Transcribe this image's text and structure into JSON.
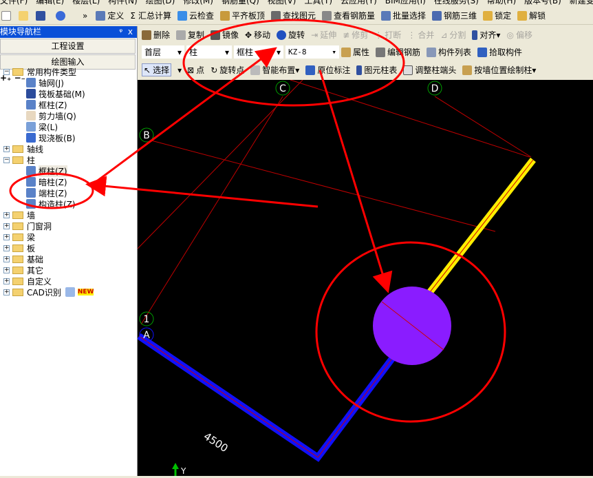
{
  "menu": [
    "文件(F)",
    "编辑(E)",
    "楼层(L)",
    "构件(N)",
    "绘图(D)",
    "修改(M)",
    "钢筋量(Q)",
    "视图(V)",
    "工具(T)",
    "云应用(Y)",
    "BIM应用(I)",
    "在线服务(S)",
    "帮助(H)",
    "版本号(B)",
    "新建变更"
  ],
  "toolbar1": [
    "定义",
    "汇总计算",
    "云检查",
    "平齐板顶",
    "查找图元",
    "查看钢筋量",
    "批量选择",
    "钢筋三维",
    "锁定",
    "解锁"
  ],
  "toolbar2": [
    {
      "label": "删除",
      "enabled": true
    },
    {
      "label": "复制",
      "enabled": true
    },
    {
      "label": "镜像",
      "enabled": true
    },
    {
      "label": "移动",
      "enabled": true
    },
    {
      "label": "旋转",
      "enabled": true
    },
    {
      "label": "延伸",
      "enabled": false
    },
    {
      "label": "修剪",
      "enabled": false
    },
    {
      "label": "打断",
      "enabled": false
    },
    {
      "label": "合并",
      "enabled": false
    },
    {
      "label": "分割",
      "enabled": false
    },
    {
      "label": "对齐",
      "enabled": true
    },
    {
      "label": "偏移",
      "enabled": false
    }
  ],
  "selectors": {
    "floor": "首层",
    "category": "柱",
    "type": "框柱",
    "component": "KZ-8"
  },
  "toolbar3": [
    "属性",
    "编辑钢筋",
    "构件列表",
    "拾取构件"
  ],
  "toolbar4": [
    "选择",
    "点",
    "旋转点",
    "智能布置",
    "原位标注",
    "图元柱表",
    "调整柱端头",
    "按墙位置绘制柱"
  ],
  "nav": {
    "title": "模块导航栏",
    "pin": "ᵠ",
    "close": "x",
    "btn1": "工程设置",
    "btn2": "绘图输入"
  },
  "tree": {
    "group1": "常用构件类型",
    "group1_items": [
      "轴网(J)",
      "筏板基础(M)",
      "框柱(Z)",
      "剪力墙(Q)",
      "梁(L)",
      "现浇板(B)"
    ],
    "axis": "轴线",
    "column": "柱",
    "column_items": [
      "框柱(Z)",
      "暗柱(Z)",
      "端柱(Z)",
      "构造柱(Z)"
    ],
    "others": [
      "墙",
      "门窗洞",
      "梁",
      "板",
      "基础",
      "其它",
      "自定义",
      "CAD识别"
    ],
    "new_badge": "NEW"
  },
  "canvas": {
    "axis_labels": [
      "C",
      "D",
      "B",
      "1",
      "A"
    ],
    "dimension": "4500",
    "y_axis": "Y"
  },
  "colors": {
    "annotation": "#ff0000",
    "column": "#8a1cff",
    "wall_yellow": "#ffee00",
    "wall_blue": "#1010ff",
    "grid": "#c00000"
  }
}
